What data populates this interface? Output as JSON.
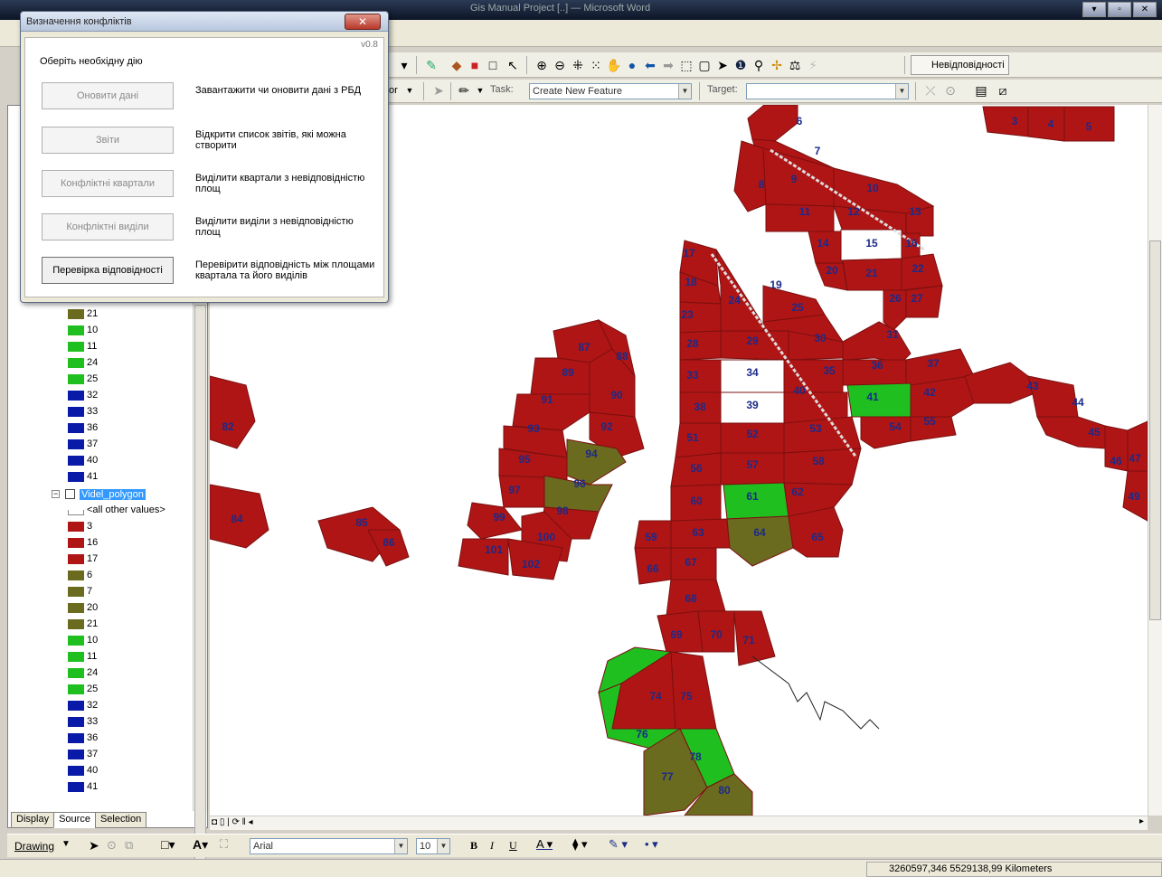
{
  "window": {
    "title": "Gis Manual Project [..] — Microsoft Word"
  },
  "toolbar": {
    "task_label": "Task:",
    "task_value": "Create New Feature",
    "target_label": "Target:",
    "editor_fragment": "or",
    "inconsistencies_label": "Невідповідності"
  },
  "dialog": {
    "title": "Визначення конфліктів",
    "version": "v0.8",
    "prompt": "Оберіть необхідну дію",
    "actions": [
      {
        "label": "Оновити дані",
        "desc": "Завантажити чи оновити дані з РБД",
        "enabled": false
      },
      {
        "label": "Звіти",
        "desc": "Відкрити список звітів, які можна створити",
        "enabled": false
      },
      {
        "label": "Конфліктні квартали",
        "desc": "Виділити квартали з невідповідністю площ",
        "enabled": false
      },
      {
        "label": "Конфліктні виділи",
        "desc": "Виділити виділи з невідповідністю площ",
        "enabled": false
      },
      {
        "label": "Перевірка відповідності",
        "desc": "Перевірити відповідність між площами квартала та його виділів",
        "enabled": true
      }
    ]
  },
  "toc": {
    "upper_items": [
      {
        "label": "21",
        "color": "#6b6b1f"
      },
      {
        "label": "10",
        "color": "#1fbf1f"
      },
      {
        "label": "11",
        "color": "#1fbf1f"
      },
      {
        "label": "24",
        "color": "#1fbf1f"
      },
      {
        "label": "25",
        "color": "#1fbf1f"
      },
      {
        "label": "32",
        "color": "#0a1aa8"
      },
      {
        "label": "33",
        "color": "#0a1aa8"
      },
      {
        "label": "36",
        "color": "#0a1aa8"
      },
      {
        "label": "37",
        "color": "#0a1aa8"
      },
      {
        "label": "40",
        "color": "#0a1aa8"
      },
      {
        "label": "41",
        "color": "#0a1aa8"
      }
    ],
    "layer_name": "Videl_polygon",
    "all_other": "<all other values>",
    "lower_items": [
      {
        "label": "3",
        "color": "#b01515"
      },
      {
        "label": "16",
        "color": "#b01515"
      },
      {
        "label": "17",
        "color": "#b01515"
      },
      {
        "label": "6",
        "color": "#6b6b1f"
      },
      {
        "label": "7",
        "color": "#6b6b1f"
      },
      {
        "label": "20",
        "color": "#6b6b1f"
      },
      {
        "label": "21",
        "color": "#6b6b1f"
      },
      {
        "label": "10",
        "color": "#1fbf1f"
      },
      {
        "label": "11",
        "color": "#1fbf1f"
      },
      {
        "label": "24",
        "color": "#1fbf1f"
      },
      {
        "label": "25",
        "color": "#1fbf1f"
      },
      {
        "label": "32",
        "color": "#0a1aa8"
      },
      {
        "label": "33",
        "color": "#0a1aa8"
      },
      {
        "label": "36",
        "color": "#0a1aa8"
      },
      {
        "label": "37",
        "color": "#0a1aa8"
      },
      {
        "label": "40",
        "color": "#0a1aa8"
      },
      {
        "label": "41",
        "color": "#0a1aa8"
      }
    ],
    "tabs": [
      "Display",
      "Source",
      "Selection"
    ]
  },
  "drawing": {
    "label": "Drawing",
    "font": "Arial",
    "size": "10"
  },
  "status": {
    "coords": "3260597,346  5529138,99 Kilometers"
  },
  "map": {
    "colors": {
      "red": "#b01515",
      "olive": "#6b6b1f",
      "green": "#1fbf1f",
      "white": "#ffffff",
      "label": "#1a2a8a"
    },
    "labels": [
      "3",
      "4",
      "5",
      "6",
      "7",
      "8",
      "9",
      "10",
      "11",
      "12",
      "13",
      "14",
      "15",
      "16",
      "17",
      "18",
      "19",
      "20",
      "21",
      "22",
      "23",
      "24",
      "25",
      "26",
      "27",
      "28",
      "29",
      "30",
      "31",
      "33",
      "34",
      "35",
      "36",
      "37",
      "38",
      "39",
      "40",
      "41",
      "42",
      "43",
      "44",
      "45",
      "46",
      "47",
      "49",
      "51",
      "52",
      "53",
      "54",
      "55",
      "56",
      "57",
      "58",
      "59",
      "60",
      "61",
      "62",
      "63",
      "64",
      "65",
      "66",
      "67",
      "68",
      "69",
      "70",
      "71",
      "74",
      "75",
      "76",
      "77",
      "78",
      "80",
      "82",
      "84",
      "85",
      "86",
      "87",
      "88",
      "89",
      "90",
      "91",
      "92",
      "93",
      "94",
      "95",
      "96",
      "97",
      "98",
      "99",
      "100",
      "101",
      "102"
    ]
  }
}
